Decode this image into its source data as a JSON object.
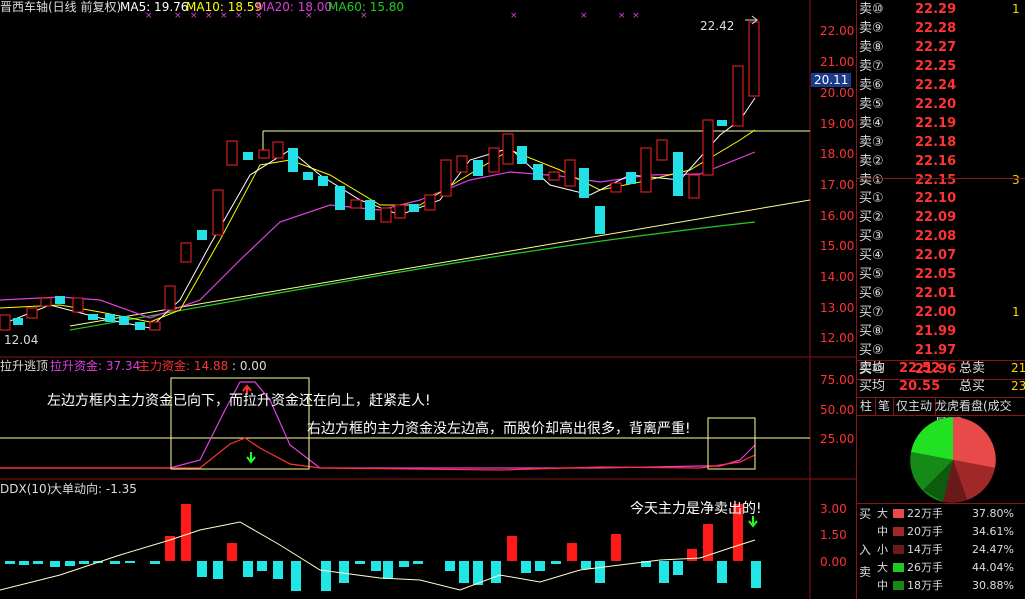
{
  "header": {
    "title": "晋西车轴(日线 前复权)",
    "ma5": "MA5: 19.76",
    "ma10": "MA10: 18.59",
    "ma20": "MA20: 18.00",
    "ma60": "MA60: 15.80"
  },
  "price_axis": [
    "22.00",
    "21.00",
    "20.00",
    "19.00",
    "18.00",
    "17.00",
    "16.00",
    "15.00",
    "14.00",
    "13.00",
    "12.00"
  ],
  "price_axis_highlight": "20.11",
  "high_marker": "22.42",
  "low_marker": "12.04",
  "indicator1": {
    "name": "拉升逃顶",
    "lift_fund": "拉升资金: 37.34",
    "main_fund": "主力资金: 14.88",
    "extra": ": 0.00",
    "axis": [
      "75.00",
      "50.00",
      "25.00"
    ]
  },
  "annotations": {
    "left_box": "左边方框内主力资金已向下，而拉升资金还在向上，赶紧走人!",
    "right_box": "右边方框的主力资金没左边高，而股价却高出很多，背离严重!",
    "today": "今天主力是净卖出的!"
  },
  "indicator2": {
    "name": "DDX(10)",
    "big_order": "大单动向: -1.35",
    "axis": [
      "3.00",
      "1.50",
      "0.00"
    ]
  },
  "order_book": {
    "sells": [
      {
        "label": "卖⑩",
        "price": "22.29",
        "vol": "1"
      },
      {
        "label": "卖⑨",
        "price": "22.28",
        "vol": ""
      },
      {
        "label": "卖⑧",
        "price": "22.27",
        "vol": ""
      },
      {
        "label": "卖⑦",
        "price": "22.25",
        "vol": ""
      },
      {
        "label": "卖⑥",
        "price": "22.24",
        "vol": ""
      },
      {
        "label": "卖⑤",
        "price": "22.20",
        "vol": ""
      },
      {
        "label": "卖④",
        "price": "22.19",
        "vol": ""
      },
      {
        "label": "卖③",
        "price": "22.18",
        "vol": ""
      },
      {
        "label": "卖②",
        "price": "22.16",
        "vol": ""
      },
      {
        "label": "卖①",
        "price": "22.15",
        "vol": "3"
      }
    ],
    "buys": [
      {
        "label": "买①",
        "price": "22.10",
        "vol": ""
      },
      {
        "label": "买②",
        "price": "22.09",
        "vol": ""
      },
      {
        "label": "买③",
        "price": "22.08",
        "vol": ""
      },
      {
        "label": "买④",
        "price": "22.07",
        "vol": ""
      },
      {
        "label": "买⑤",
        "price": "22.05",
        "vol": ""
      },
      {
        "label": "买⑥",
        "price": "22.01",
        "vol": ""
      },
      {
        "label": "买⑦",
        "price": "22.00",
        "vol": "1"
      },
      {
        "label": "买⑧",
        "price": "21.99",
        "vol": ""
      },
      {
        "label": "买⑨",
        "price": "21.97",
        "vol": ""
      },
      {
        "label": "买⑩",
        "price": "21.96",
        "vol": ""
      }
    ],
    "sell_avg_label": "卖均",
    "sell_avg": "22.52",
    "total_sell_label": "总卖",
    "total_sell": "21",
    "buy_avg_label": "买均",
    "buy_avg": "20.55",
    "total_buy_label": "总买",
    "total_buy": "23"
  },
  "tabs": [
    "柱",
    "笔",
    "仅主动",
    "龙虎看盘(成交量/成"
  ],
  "fund_flow": {
    "buy_side": "买",
    "in_label": "入",
    "sell_side": "卖",
    "rows": [
      {
        "size": "大",
        "amount": "22万手",
        "pct": "37.80%",
        "color": "#e84a4a"
      },
      {
        "size": "中",
        "amount": "20万手",
        "pct": "34.61%",
        "color": "#a02828"
      },
      {
        "size": "小",
        "amount": "14万手",
        "pct": "24.47%",
        "color": "#6a1a1a"
      },
      {
        "size": "大",
        "amount": "26万手",
        "pct": "44.04%",
        "color": "#22c822"
      },
      {
        "size": "中",
        "amount": "18万手",
        "pct": "30.88%",
        "color": "#168a16"
      }
    ]
  },
  "colors": {
    "up": "#ff2222",
    "down": "#22e0e6",
    "ma5": "#ffffff",
    "ma10": "#ffff00",
    "ma20": "#e040e0",
    "ma60": "#22cc22",
    "axis": "#8a1515"
  }
}
